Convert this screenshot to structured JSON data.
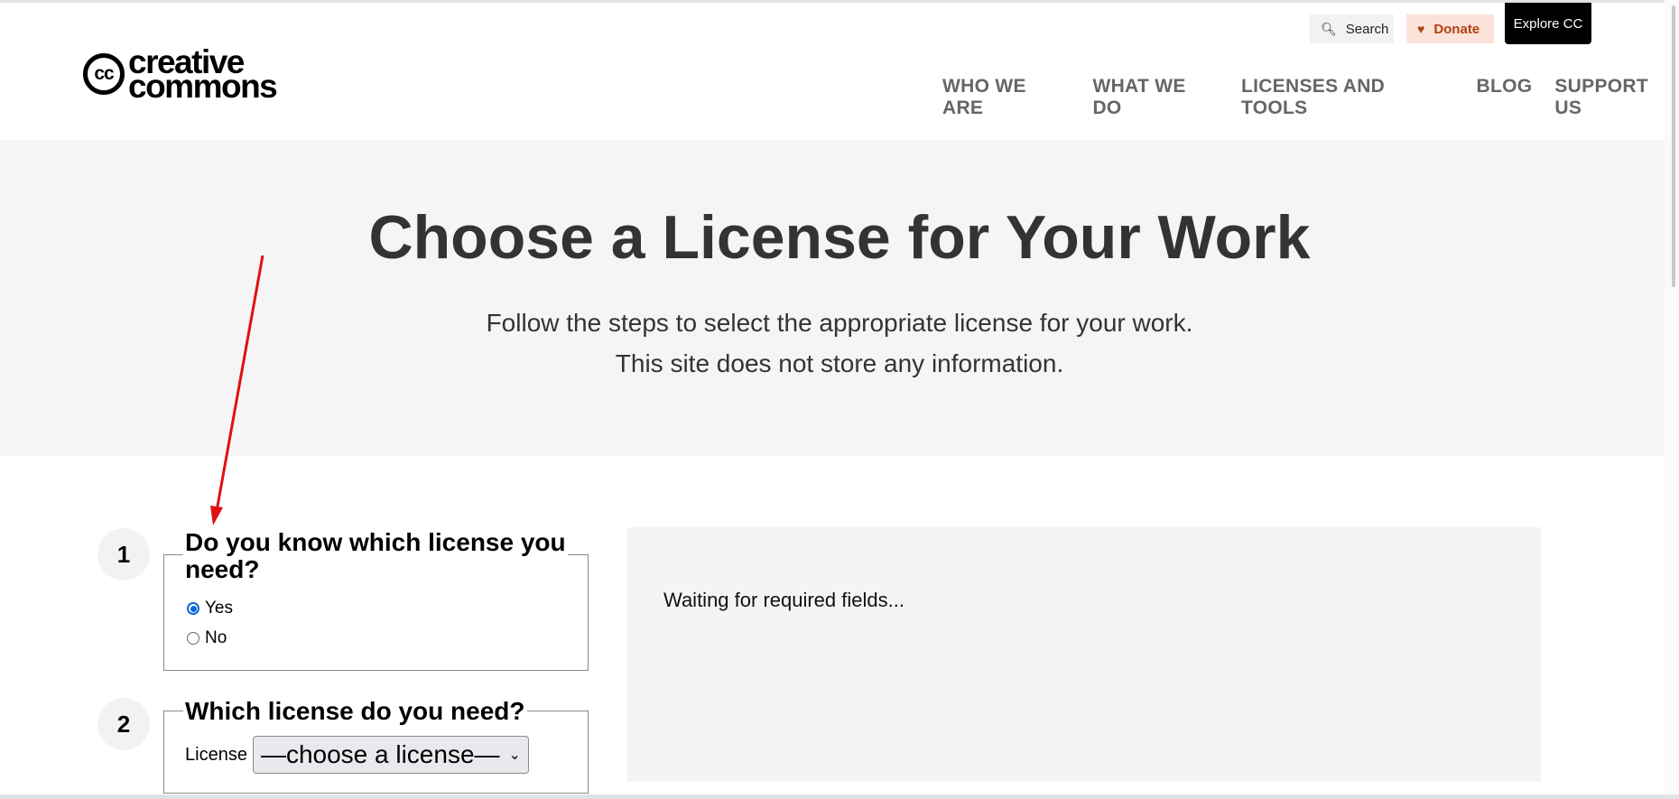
{
  "header": {
    "logo": {
      "line1": "creative",
      "line2": "commons",
      "mark": "cc"
    },
    "utility": {
      "search_label": "Search",
      "search_icon": "search-icon",
      "donate_label": "Donate",
      "donate_icon": "heart-icon",
      "explore_label": "Explore CC"
    },
    "nav": [
      "WHO WE ARE",
      "WHAT WE DO",
      "LICENSES AND TOOLS",
      "BLOG",
      "SUPPORT US"
    ]
  },
  "hero": {
    "title": "Choose a License for Your Work",
    "subtitle_line1": "Follow the steps to select the appropriate license for your work.",
    "subtitle_line2": "This site does not store any information."
  },
  "steps": [
    {
      "number": "1",
      "question_line1": "Do you know which license you",
      "question_line2": "need?",
      "options": [
        {
          "label": "Yes",
          "selected": true
        },
        {
          "label": "No",
          "selected": false
        }
      ]
    },
    {
      "number": "2",
      "question": "Which license do you need?",
      "field_label": "License",
      "select_value": "—choose a license—"
    }
  ],
  "result": {
    "status": "Waiting for required fields..."
  },
  "colors": {
    "hero_bg": "#f5f5f5",
    "nav_text": "#666666",
    "donate_bg": "#fbe3da",
    "donate_text": "#b04010",
    "radio_accent": "#0a66d6",
    "annotation_arrow": "#e01010"
  }
}
